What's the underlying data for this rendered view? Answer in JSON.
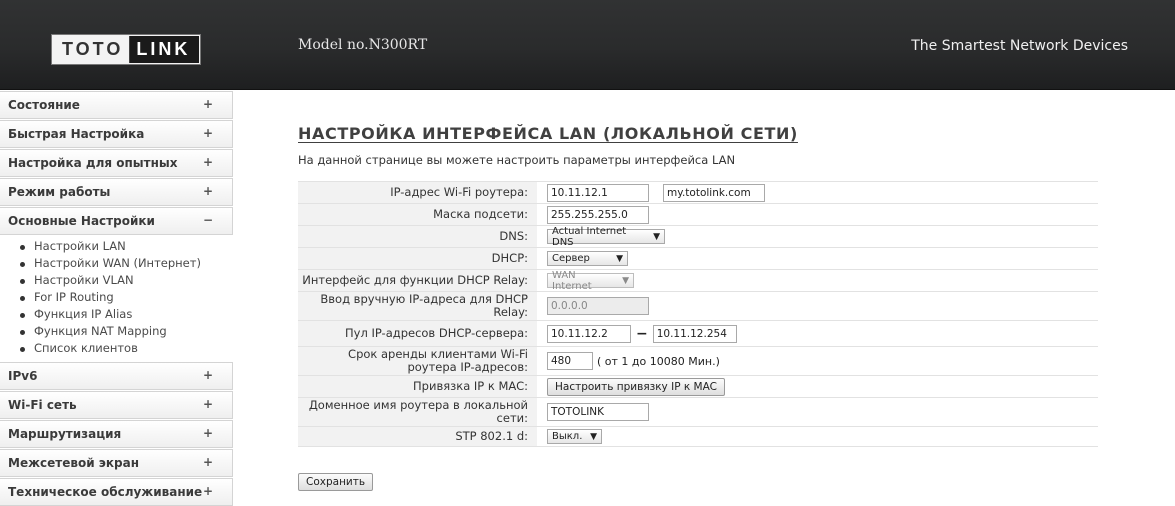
{
  "header": {
    "logo_left": "TOTO",
    "logo_right": "LINK",
    "model": "Model no.N300RT",
    "tagline": "The Smartest Network Devices"
  },
  "sidebar": {
    "items_top": [
      {
        "label": "Состояние",
        "sign": "+"
      },
      {
        "label": "Быстрая Настройка",
        "sign": "+"
      },
      {
        "label": "Настройка для опытных",
        "sign": "+"
      },
      {
        "label": "Режим работы",
        "sign": "+"
      },
      {
        "label": "Основные Настройки",
        "sign": "−"
      }
    ],
    "subitems": [
      "Настройки LAN",
      "Настройки WAN (Интернет)",
      "Настройки VLAN",
      "For IP Routing",
      "Функция IP Alias",
      "Функция NAT Mapping",
      "Список клиентов"
    ],
    "items_bottom": [
      {
        "label": "IPv6",
        "sign": "+"
      },
      {
        "label": "Wi-Fi сеть",
        "sign": "+"
      },
      {
        "label": "Маршрутизация",
        "sign": "+"
      },
      {
        "label": "Межсетевой экран",
        "sign": "+"
      },
      {
        "label": "Техническое обслуживание",
        "sign": "+"
      }
    ]
  },
  "page": {
    "title": "НАСТРОЙКА ИНТЕРФЕЙСА LAN (ЛОКАЛЬНОЙ СЕТИ)",
    "description": "На данной странице вы можете настроить параметры интерфейса LAN"
  },
  "form": {
    "ip_label": "IP-адрес Wi-Fi роутера:",
    "ip_value": "10.11.12.1",
    "domain_value": "my.totolink.com",
    "mask_label": "Маска подсети:",
    "mask_value": "255.255.255.0",
    "dns_label": "DNS:",
    "dns_value": "Actual Internet DNS",
    "dhcp_label": "DHCP:",
    "dhcp_value": "Сервер",
    "relay_iface_label": "Интерфейс для функции DHCP Relay:",
    "relay_iface_value": "WAN Internet",
    "relay_ip_label": "Ввод вручную IP-адреса для DHCP Relay:",
    "relay_ip_value": "0.0.0.0",
    "pool_label": "Пул IP-адресов DHCP-сервера:",
    "pool_start": "10.11.12.2",
    "pool_dash": "−",
    "pool_end": "10.11.12.254",
    "lease_label": "Срок аренды клиентами Wi-Fi роутера IP-адресов:",
    "lease_value": "480",
    "lease_hint": "( от 1 до 10080 Мин.)",
    "bind_label": "Привязка IP к MAC:",
    "bind_button": "Настроить привязку IP к MAC",
    "hostname_label": "Доменное имя роутера в локальной сети:",
    "hostname_value": "TOTOLINK",
    "stp_label": "STP 802.1 d:",
    "stp_value": "Выкл.",
    "arrow": "▼"
  },
  "save_label": "Сохранить"
}
